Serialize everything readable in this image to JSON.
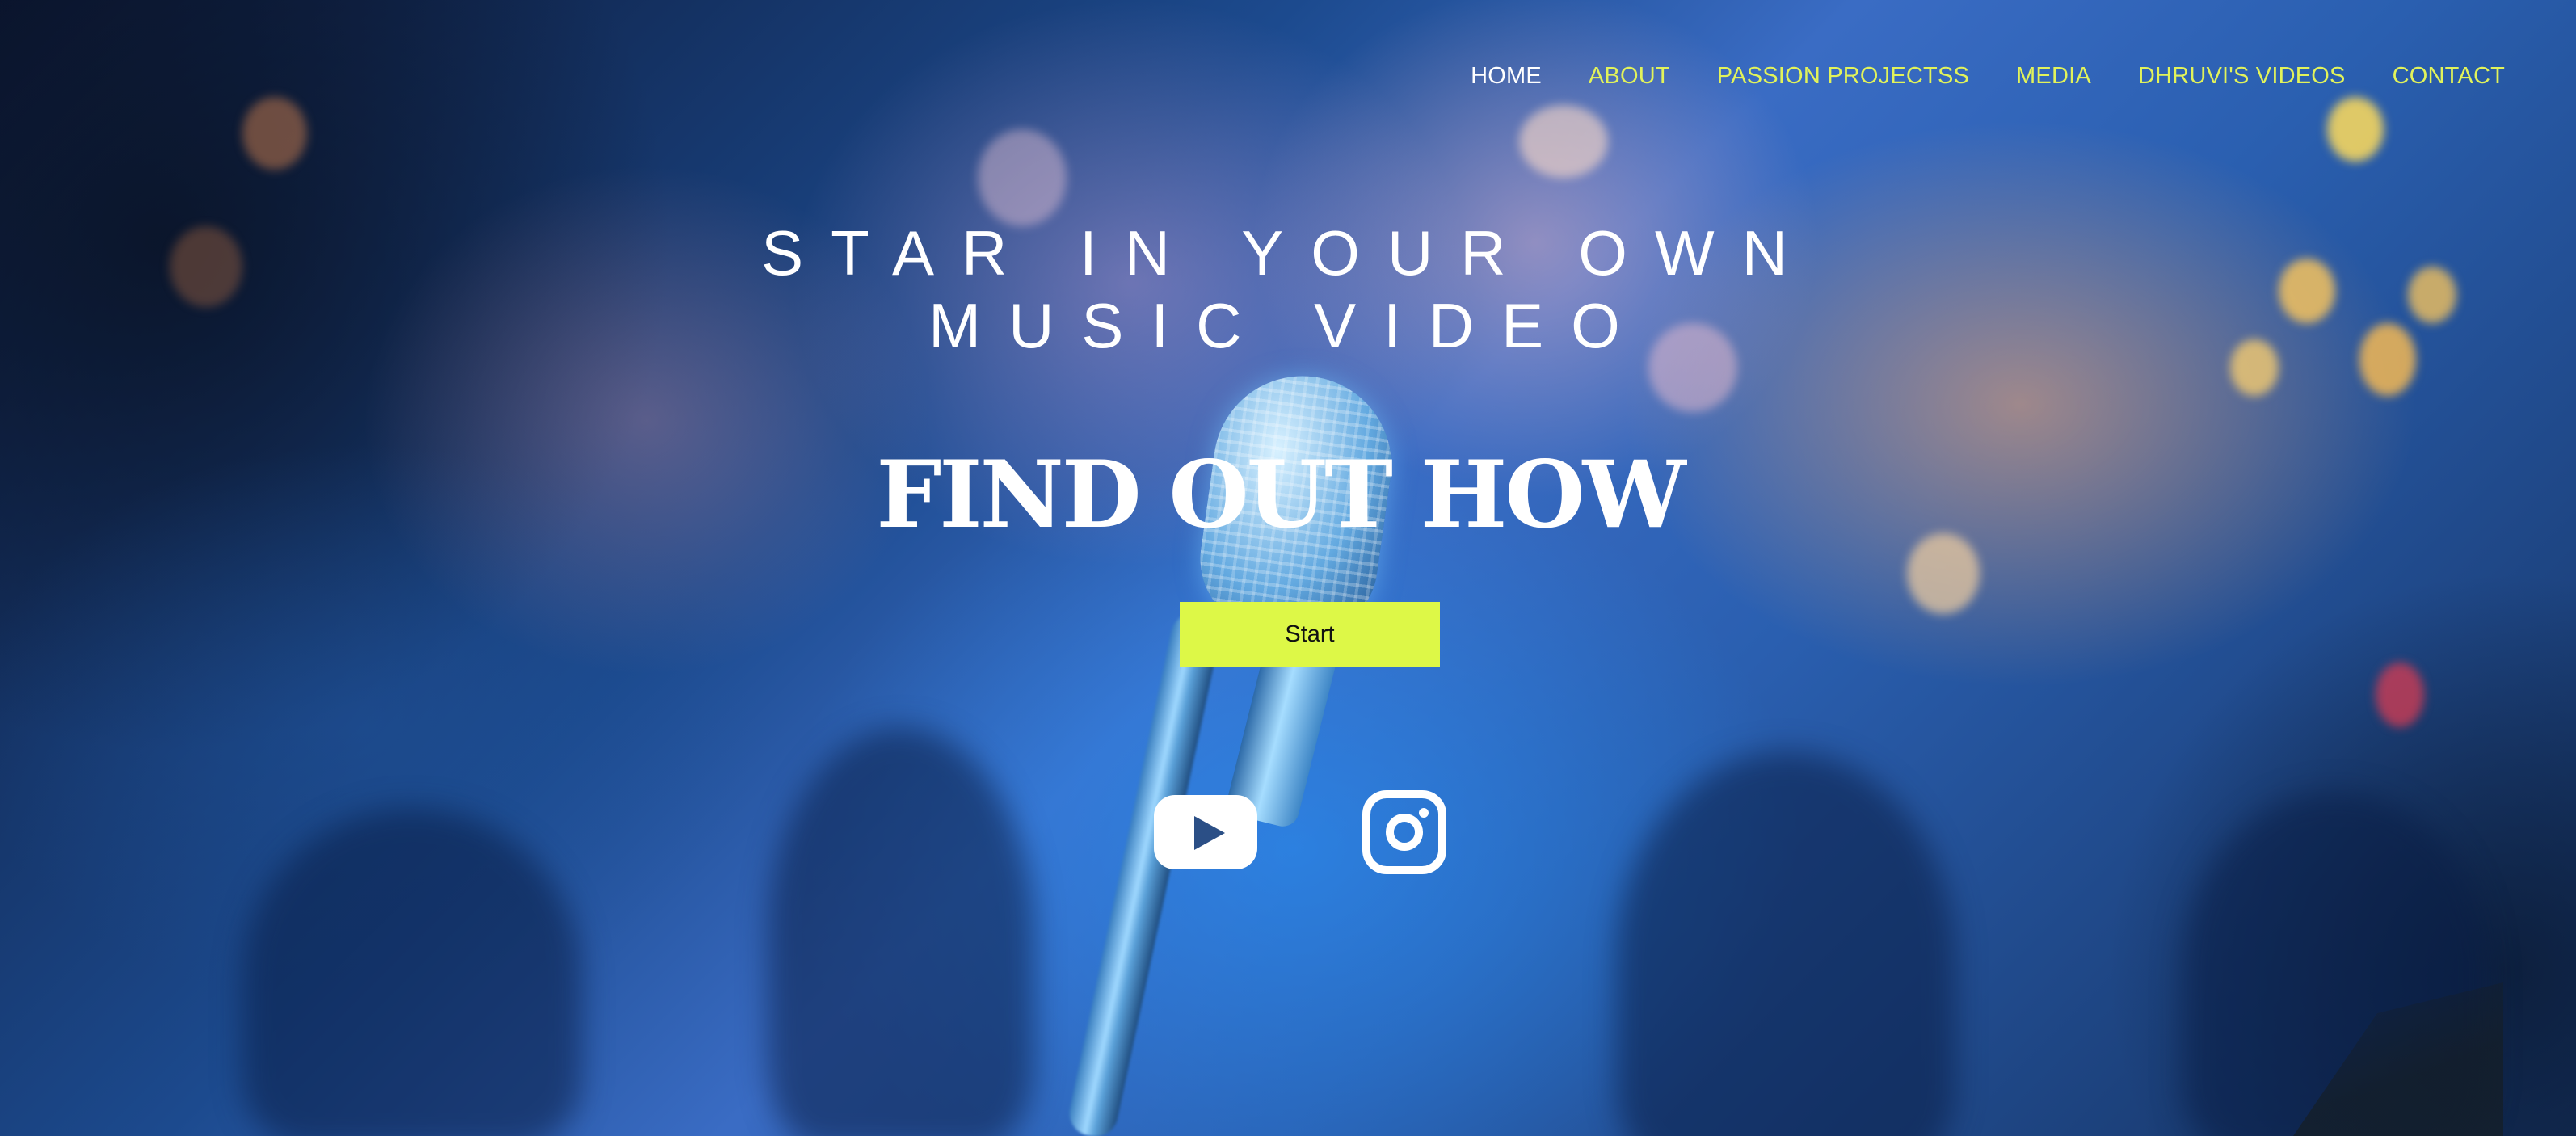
{
  "nav": {
    "items": [
      {
        "label": "HOME"
      },
      {
        "label": "ABOUT"
      },
      {
        "label": "PASSION PROJECTSS"
      },
      {
        "label": "MEDIA"
      },
      {
        "label": "DHRUVI'S VIDEOS"
      },
      {
        "label": "CONTACT"
      }
    ],
    "active_color": "#ffffff",
    "link_color": "#e2f35a"
  },
  "hero": {
    "headline_line1": "STAR IN YOUR OWN",
    "headline_line2": "MUSIC VIDEO",
    "subhead": "FIND OUT HOW",
    "cta_label": "Start",
    "cta_color": "#ddf847"
  },
  "social": {
    "icons": [
      "youtube-icon",
      "instagram-icon"
    ]
  },
  "background": {
    "subject": "stage-microphone-icon"
  }
}
